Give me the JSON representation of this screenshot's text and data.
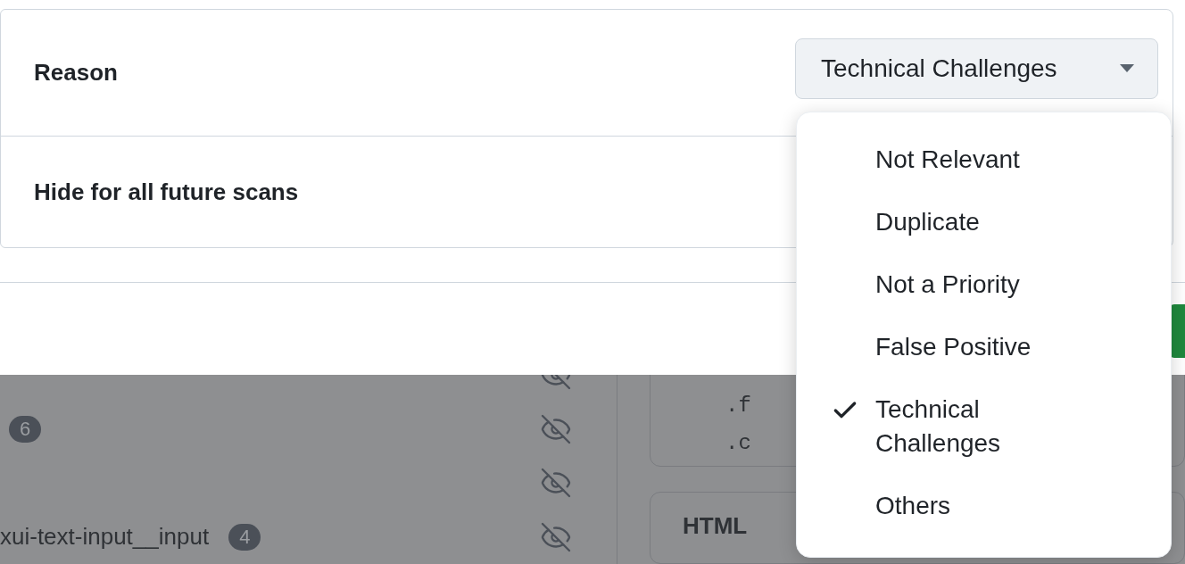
{
  "dialog": {
    "rows": [
      {
        "label": "Reason",
        "kind": "select",
        "value": "Technical Challenges"
      },
      {
        "label": "Hide for all future scans",
        "kind": "plain"
      }
    ]
  },
  "dropdown": {
    "options": [
      {
        "label": "Not Relevant",
        "selected": false
      },
      {
        "label": "Duplicate",
        "selected": false
      },
      {
        "label": "Not a Priority",
        "selected": false
      },
      {
        "label": "False Positive",
        "selected": false
      },
      {
        "label": "Technical Challenges",
        "selected": true
      },
      {
        "label": "Others",
        "selected": false
      }
    ]
  },
  "background": {
    "items": [
      {
        "kind": "badge",
        "count": "6"
      },
      {
        "kind": "icon-only"
      },
      {
        "kind": "text",
        "text": "xui-text-input__input",
        "count": "4"
      }
    ],
    "code_lines": [
      ".f",
      ".c"
    ],
    "section_heading": "HTML"
  }
}
